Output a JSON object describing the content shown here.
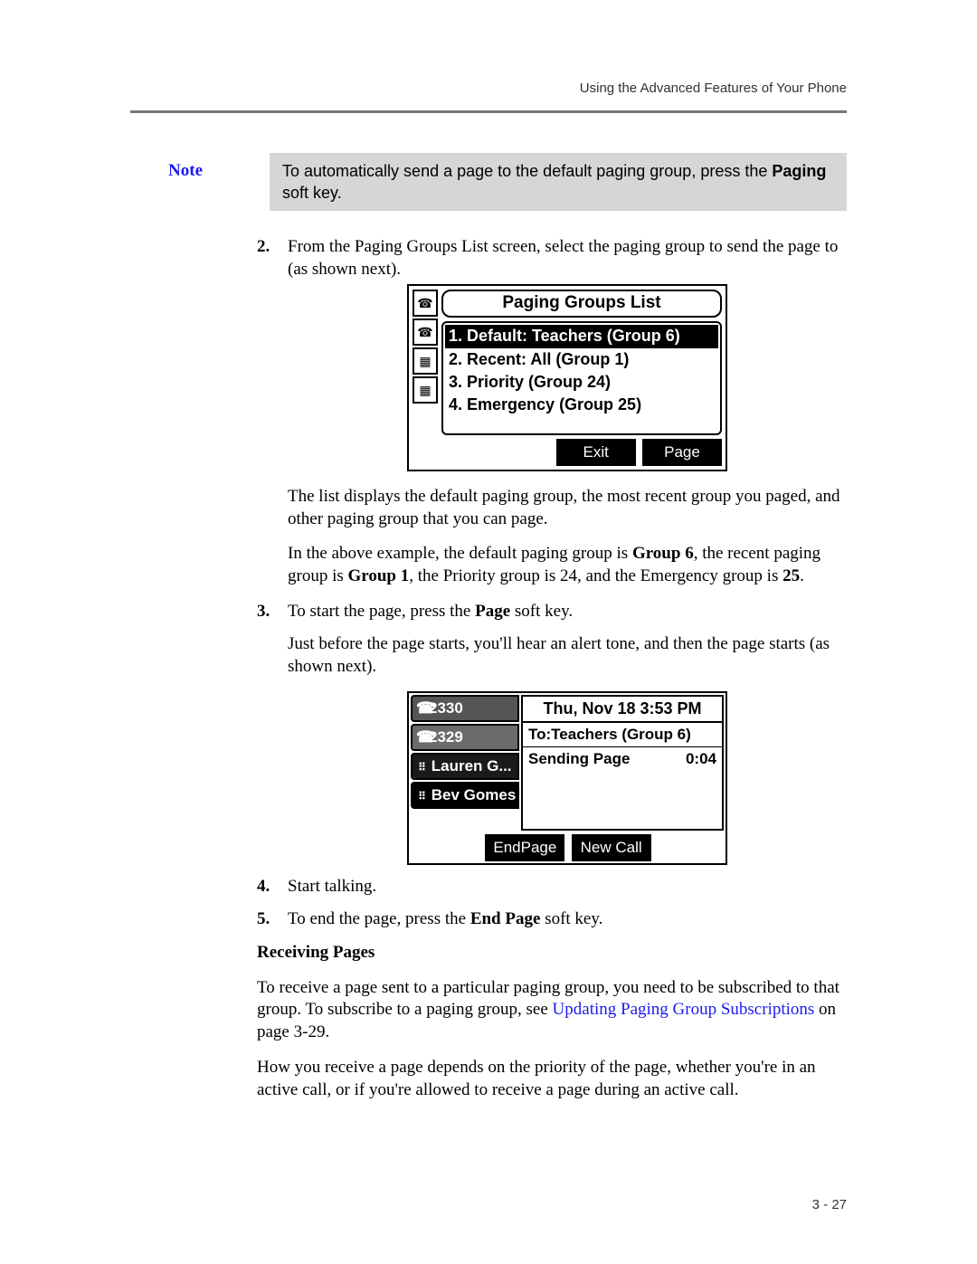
{
  "running_head": "Using the Advanced Features of Your Phone",
  "note_label": "Note",
  "note_body_pre": "To automatically send a page to the default paging group, press the ",
  "note_body_bold": "Paging",
  "note_body_post": " soft key.",
  "step2_num": "2.",
  "step2_text": "From the Paging Groups List screen, select the paging group to send the page to (as shown next).",
  "screen1": {
    "title": "Paging Groups List",
    "items": [
      "1. Default: Teachers (Group 6)",
      "2. Recent: All (Group 1)",
      "3. Priority (Group 24)",
      "4. Emergency (Group 25)"
    ],
    "softkey_exit": "Exit",
    "softkey_page": "Page"
  },
  "after_s1_p1": "The list displays the default paging group, the most recent group you paged, and other paging group that you can page.",
  "after_s1_p2_pre": "In the above example, the default paging group is ",
  "after_s1_p2_b1": "Group 6",
  "after_s1_p2_mid1": ", the recent paging group is ",
  "after_s1_p2_b2": "Group 1",
  "after_s1_p2_mid2": ", the Priority group is 24, and the Emergency group is ",
  "after_s1_p2_b3": "25",
  "after_s1_p2_post": ".",
  "step3_num": "3.",
  "step3_pre": "To start the page, press the ",
  "step3_bold": "Page",
  "step3_post": " soft key.",
  "step3_follow": "Just before the page starts, you'll hear an alert tone, and then the page starts (as shown next).",
  "screen2": {
    "tabs": [
      "2330",
      "2329",
      "Lauren G...",
      "Bev Gomes"
    ],
    "clock": "Thu, Nov 18   3:53 PM",
    "to_line": "To:Teachers (Group 6)",
    "sending": "Sending Page",
    "elapsed": "0:04",
    "softkey_end": "EndPage",
    "softkey_new": "New Call"
  },
  "step4_num": "4.",
  "step4_text": "Start talking.",
  "step5_num": "5.",
  "step5_pre": "To end the page, press the ",
  "step5_bold": "End Page",
  "step5_post": " soft key.",
  "recv_head": "Receiving Pages",
  "recv_p1_pre": "To receive a page sent to a particular paging group, you need to be subscribed to that group. To subscribe to a paging group, see ",
  "recv_p1_link": "Updating Paging Group Subscriptions",
  "recv_p1_post": " on page 3-29.",
  "recv_p2": "How you receive a page depends on the priority of the page, whether you're in an active call, or if you're allowed to receive a page during an active call.",
  "page_num": "3 - 27"
}
